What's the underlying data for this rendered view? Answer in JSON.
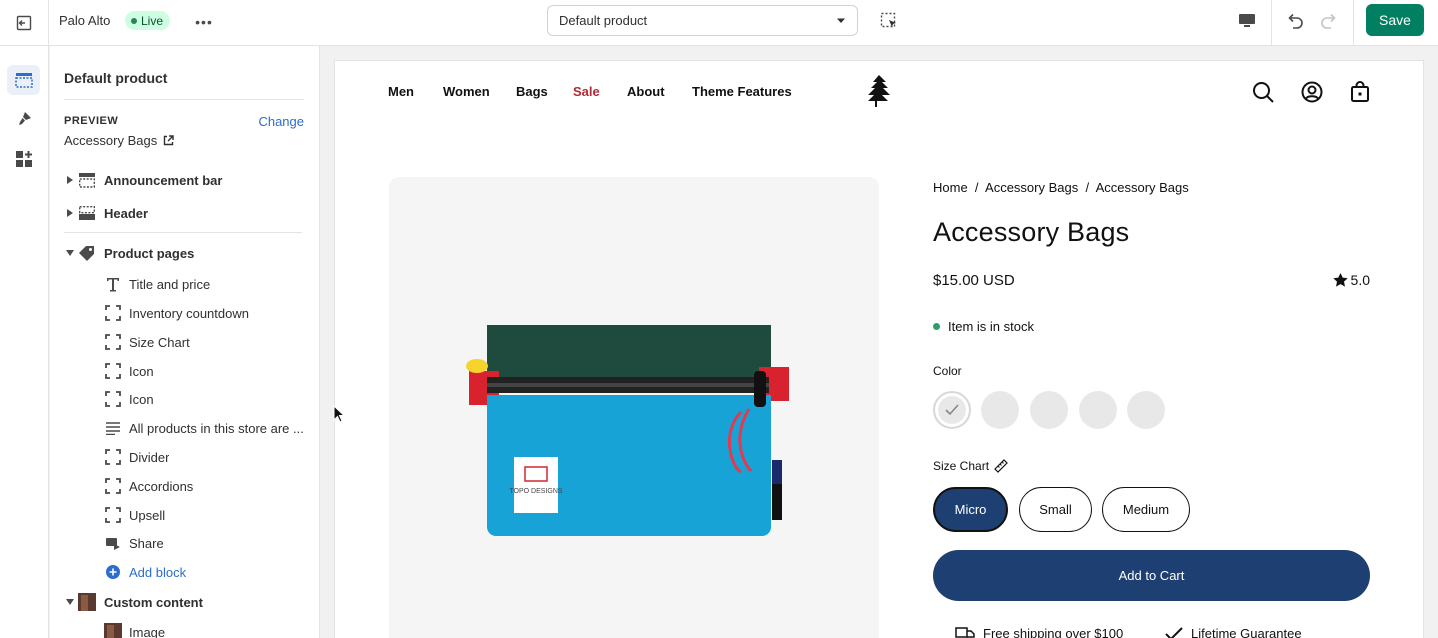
{
  "topbar": {
    "store_name": "Palo Alto",
    "live_badge": "Live",
    "template_select": "Default product",
    "save_label": "Save"
  },
  "sidebar": {
    "title": "Default product",
    "preview_label": "PREVIEW",
    "preview_change": "Change",
    "preview_value": "Accessory Bags",
    "sections": [
      {
        "label": "Announcement bar"
      },
      {
        "label": "Header"
      },
      {
        "label": "Product pages"
      },
      {
        "label": "Custom content"
      }
    ],
    "blocks": [
      {
        "label": "Title and price",
        "icon": "text-icon"
      },
      {
        "label": "Inventory countdown",
        "icon": "block-icon"
      },
      {
        "label": "Size Chart",
        "icon": "block-icon"
      },
      {
        "label": "Icon",
        "icon": "block-icon"
      },
      {
        "label": "Icon",
        "icon": "block-icon"
      },
      {
        "label": "All products in this store are ...",
        "icon": "paragraph-icon"
      },
      {
        "label": "Divider",
        "icon": "block-icon"
      },
      {
        "label": "Accordions",
        "icon": "block-icon"
      },
      {
        "label": "Upsell",
        "icon": "block-icon"
      },
      {
        "label": "Share",
        "icon": "share-icon"
      }
    ],
    "add_block": "Add block",
    "custom_child": "Image"
  },
  "store": {
    "nav": [
      "Men",
      "Women",
      "Bags",
      "Sale",
      "About",
      "Theme Features"
    ],
    "sale_color": "#b02a37",
    "breadcrumb": "Home  /  Accessory Bags  /  Accessory Bags",
    "product_title": "Accessory Bags",
    "price": "$15.00 USD",
    "rating": "5.0",
    "stock": "Item is in stock",
    "color_label": "Color",
    "size_label": "Size Chart",
    "sizes": [
      "Micro",
      "Small",
      "Medium"
    ],
    "selected_size": "Micro",
    "add_to_cart": "Add to Cart",
    "perks": [
      "Free shipping over $100",
      "Lifetime Guarantee"
    ],
    "product_image_label": "TOPO DESIGNS",
    "accent": "#1d3f72"
  }
}
